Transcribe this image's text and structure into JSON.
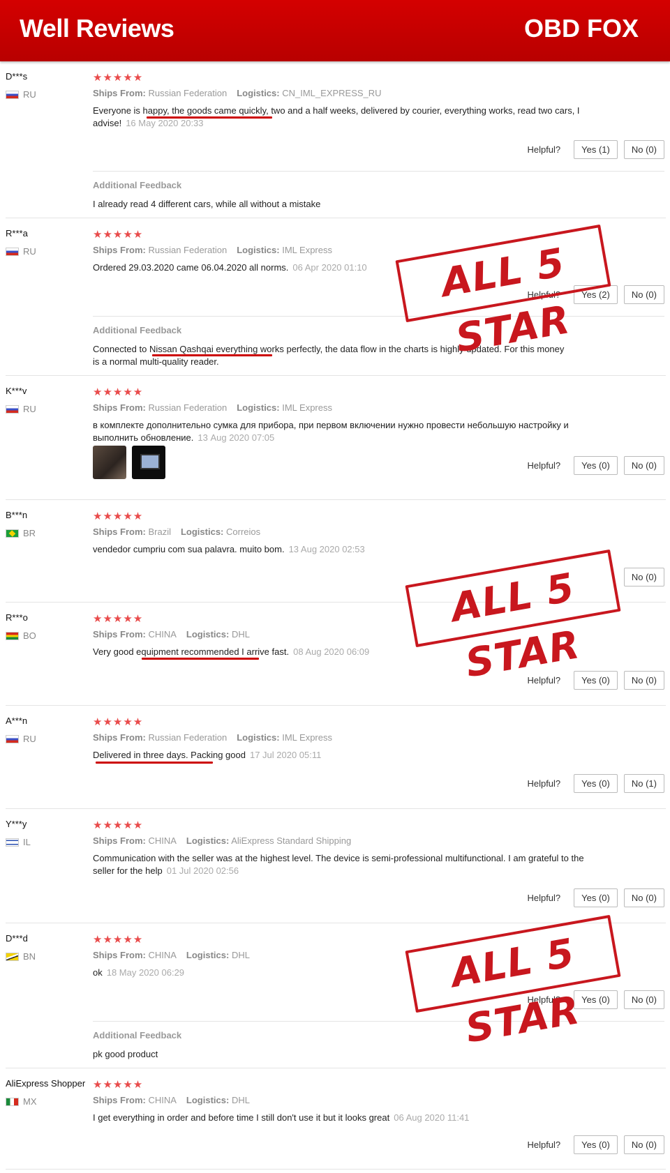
{
  "header": {
    "title": "Well Reviews",
    "brand": "OBD FOX"
  },
  "labels": {
    "ships_from": "Ships From:",
    "logistics": "Logistics:",
    "helpful": "Helpful?",
    "additional_feedback": "Additional Feedback",
    "stars": "★★★★★"
  },
  "stamp_text": "ALL 5 STAR",
  "reviews": [
    {
      "user": "D***s",
      "country": "RU",
      "ships_from": "Russian Federation",
      "logistics": "CN_IML_EXPRESS_RU",
      "text": "Everyone is happy, the goods came quickly, two and a half weeks, delivered by courier, everything works, read two cars, I advise!",
      "date": "16 May 2020 20:33",
      "yes": "Yes (1)",
      "no": "No (0)",
      "additional": "I already read 4 different cars, while all without a mistake"
    },
    {
      "user": "R***a",
      "country": "RU",
      "ships_from": "Russian Federation",
      "logistics": "IML Express",
      "text": "Ordered 29.03.2020 came 06.04.2020 all norms.",
      "date": "06 Apr 2020 01:10",
      "yes": "Yes (2)",
      "no": "No (0)",
      "additional": "Connected to Nissan Qashqai everything works perfectly, the data flow in the charts is highly updated. For this money is a normal multi-quality reader."
    },
    {
      "user": "K***v",
      "country": "RU",
      "ships_from": "Russian Federation",
      "logistics": "IML Express",
      "text": "в комплекте дополнительно сумка для прибора, при первом включении нужно провести небольшую настройку и выполнить обновление.",
      "date": "13 Aug 2020 07:05",
      "yes": "Yes (0)",
      "no": "No (0)"
    },
    {
      "user": "B***n",
      "country": "BR",
      "ships_from": "Brazil",
      "logistics": "Correios",
      "text": "vendedor cumpriu com sua palavra. muito bom.",
      "date": "13 Aug 2020 02:53",
      "no": "No (0)"
    },
    {
      "user": "R***o",
      "country": "BO",
      "ships_from": "CHINA",
      "logistics": "DHL",
      "text": "Very good equipment recommended I arrive fast.",
      "date": "08 Aug 2020 06:09",
      "yes": "Yes (0)",
      "no": "No (0)"
    },
    {
      "user": "A***n",
      "country": "RU",
      "ships_from": "Russian Federation",
      "logistics": "IML Express",
      "text": "Delivered in three days. Packing good",
      "date": "17 Jul 2020 05:11",
      "yes": "Yes (0)",
      "no": "No (1)"
    },
    {
      "user": "Y***y",
      "country": "IL",
      "ships_from": "CHINA",
      "logistics": "AliExpress Standard Shipping",
      "text": "Communication with the seller was at the highest level. The device is semi-professional multifunctional. I am grateful to the seller for the help",
      "date": "01 Jul 2020 02:56",
      "yes": "Yes (0)",
      "no": "No (0)"
    },
    {
      "user": "D***d",
      "country": "BN",
      "ships_from": "CHINA",
      "logistics": "DHL",
      "text": "ok",
      "date": "18 May 2020 06:29",
      "yes": "Yes (0)",
      "no": "No (0)",
      "additional": "pk good product"
    },
    {
      "user": "AliExpress Shopper",
      "country": "MX",
      "ships_from": "CHINA",
      "logistics": "DHL",
      "text": "I get everything in order and before time I still don't use it but it looks great",
      "date": "06 Aug 2020 11:41",
      "yes": "Yes (0)",
      "no": "No (0)"
    }
  ]
}
